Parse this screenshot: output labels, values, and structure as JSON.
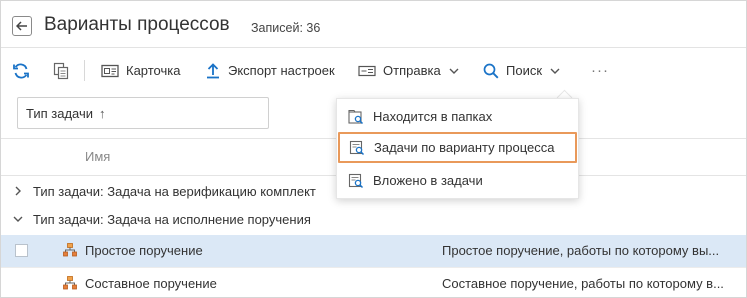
{
  "header": {
    "title": "Варианты процессов",
    "records_label": "Записей:",
    "records_count": "36"
  },
  "toolbar": {
    "refresh_icon": "refresh-icon",
    "copy_icon": "copy-icon",
    "card_label": "Карточка",
    "export_label": "Экспорт настроек",
    "send_label": "Отправка",
    "search_label": "Поиск",
    "more_label": "···"
  },
  "sort": {
    "field_label": "Тип задачи",
    "direction": "↑"
  },
  "columns": {
    "name": "Имя"
  },
  "groups": [
    {
      "label": "Тип задачи: Задача на верификацию комплект",
      "expanded": false
    },
    {
      "label": "Тип задачи: Задача на исполнение поручения",
      "expanded": true
    }
  ],
  "rows": [
    {
      "name": "Простое поручение",
      "description": "Простое поручение, работы по которому вы...",
      "selected": true
    },
    {
      "name": "Составное поручение",
      "description": "Составное поручение, работы по которому в...",
      "selected": false
    }
  ],
  "search_menu": {
    "items": [
      {
        "label": "Находится в папках"
      },
      {
        "label": "Задачи по варианту процесса"
      },
      {
        "label": "Вложено в задачи"
      }
    ]
  },
  "colors": {
    "accent": "#1a73c7",
    "selected_row": "#dbe8f6",
    "highlight_border": "#e9995a"
  }
}
